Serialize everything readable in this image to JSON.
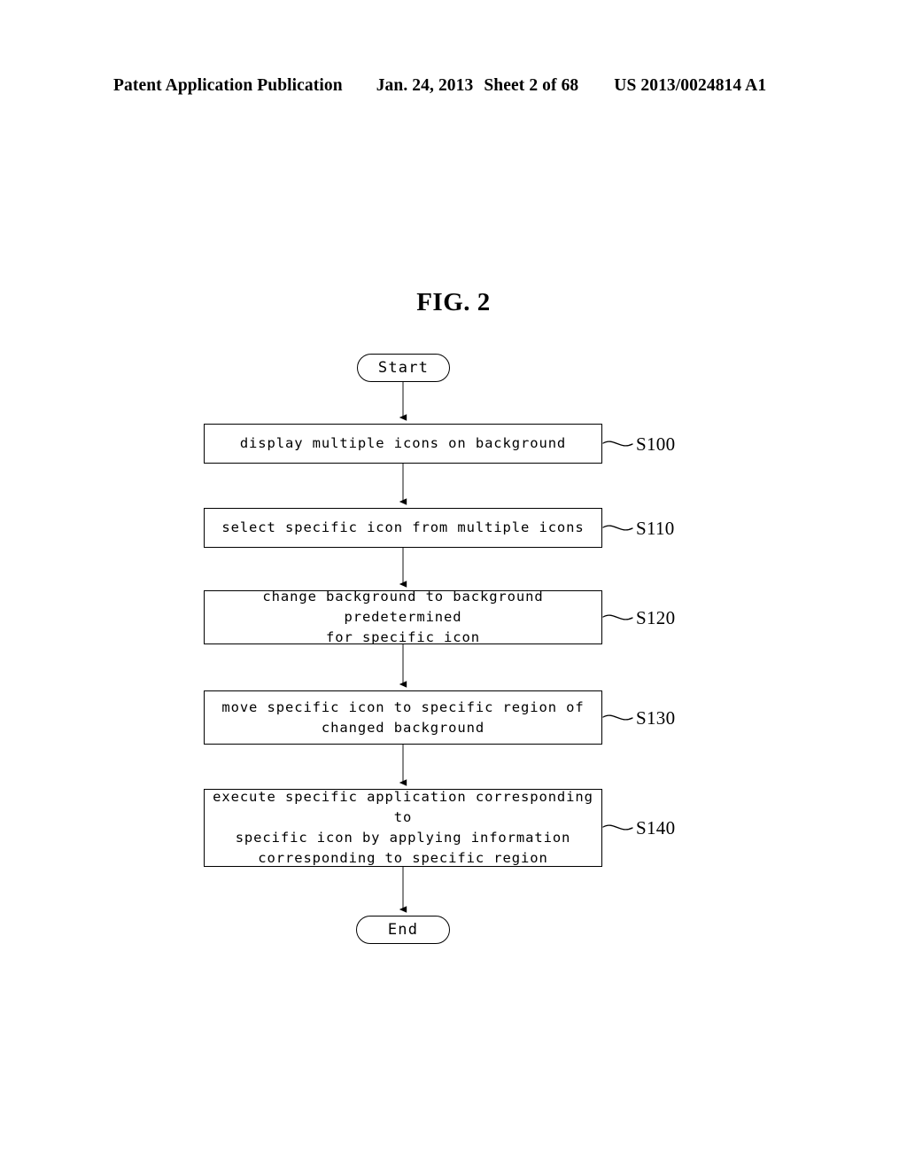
{
  "header": {
    "publication": "Patent Application Publication",
    "date": "Jan. 24, 2013",
    "sheet": "Sheet 2 of 68",
    "number": "US 2013/0024814 A1"
  },
  "figure": {
    "title": "FIG. 2"
  },
  "flowchart": {
    "start_label": "Start",
    "end_label": "End",
    "steps": [
      {
        "id": "S100",
        "text": "display multiple icons on background",
        "ref": "S100"
      },
      {
        "id": "S110",
        "text": "select specific icon from multiple icons",
        "ref": "S110"
      },
      {
        "id": "S120",
        "text": "change background to background predetermined\nfor specific icon",
        "ref": "S120"
      },
      {
        "id": "S130",
        "text": "move specific icon to specific region of\nchanged background",
        "ref": "S130"
      },
      {
        "id": "S140",
        "text": "execute specific application corresponding to\nspecific icon by applying information\ncorresponding to specific region",
        "ref": "S140"
      }
    ]
  },
  "colors": {
    "ink": "#000000",
    "paper": "#ffffff",
    "connector": "#555555"
  }
}
